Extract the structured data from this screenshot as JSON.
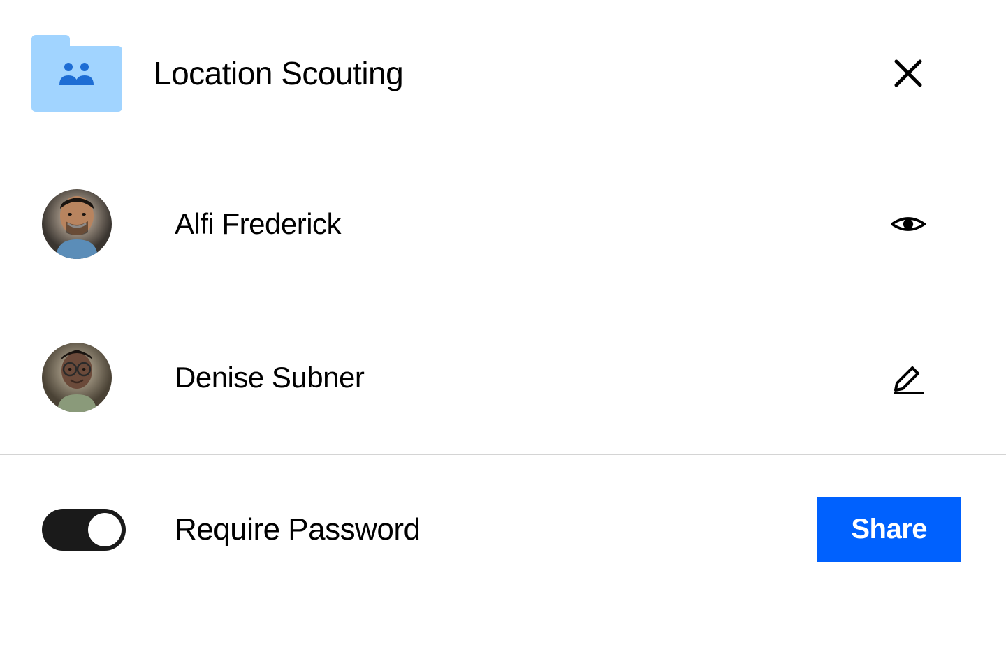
{
  "header": {
    "title": "Location Scouting",
    "folder_icon": "shared-folder-icon",
    "close_icon": "close-icon"
  },
  "people": [
    {
      "name": "Alfi Frederick",
      "permission_icon": "eye-icon",
      "avatar": "avatar-alfi"
    },
    {
      "name": "Denise Subner",
      "permission_icon": "edit-icon",
      "avatar": "avatar-denise"
    }
  ],
  "footer": {
    "toggle_label": "Require Password",
    "toggle_state": true,
    "share_label": "Share"
  },
  "colors": {
    "accent": "#0061fe",
    "folder": "#a1d4ff",
    "folder_people": "#1e6dd4"
  }
}
